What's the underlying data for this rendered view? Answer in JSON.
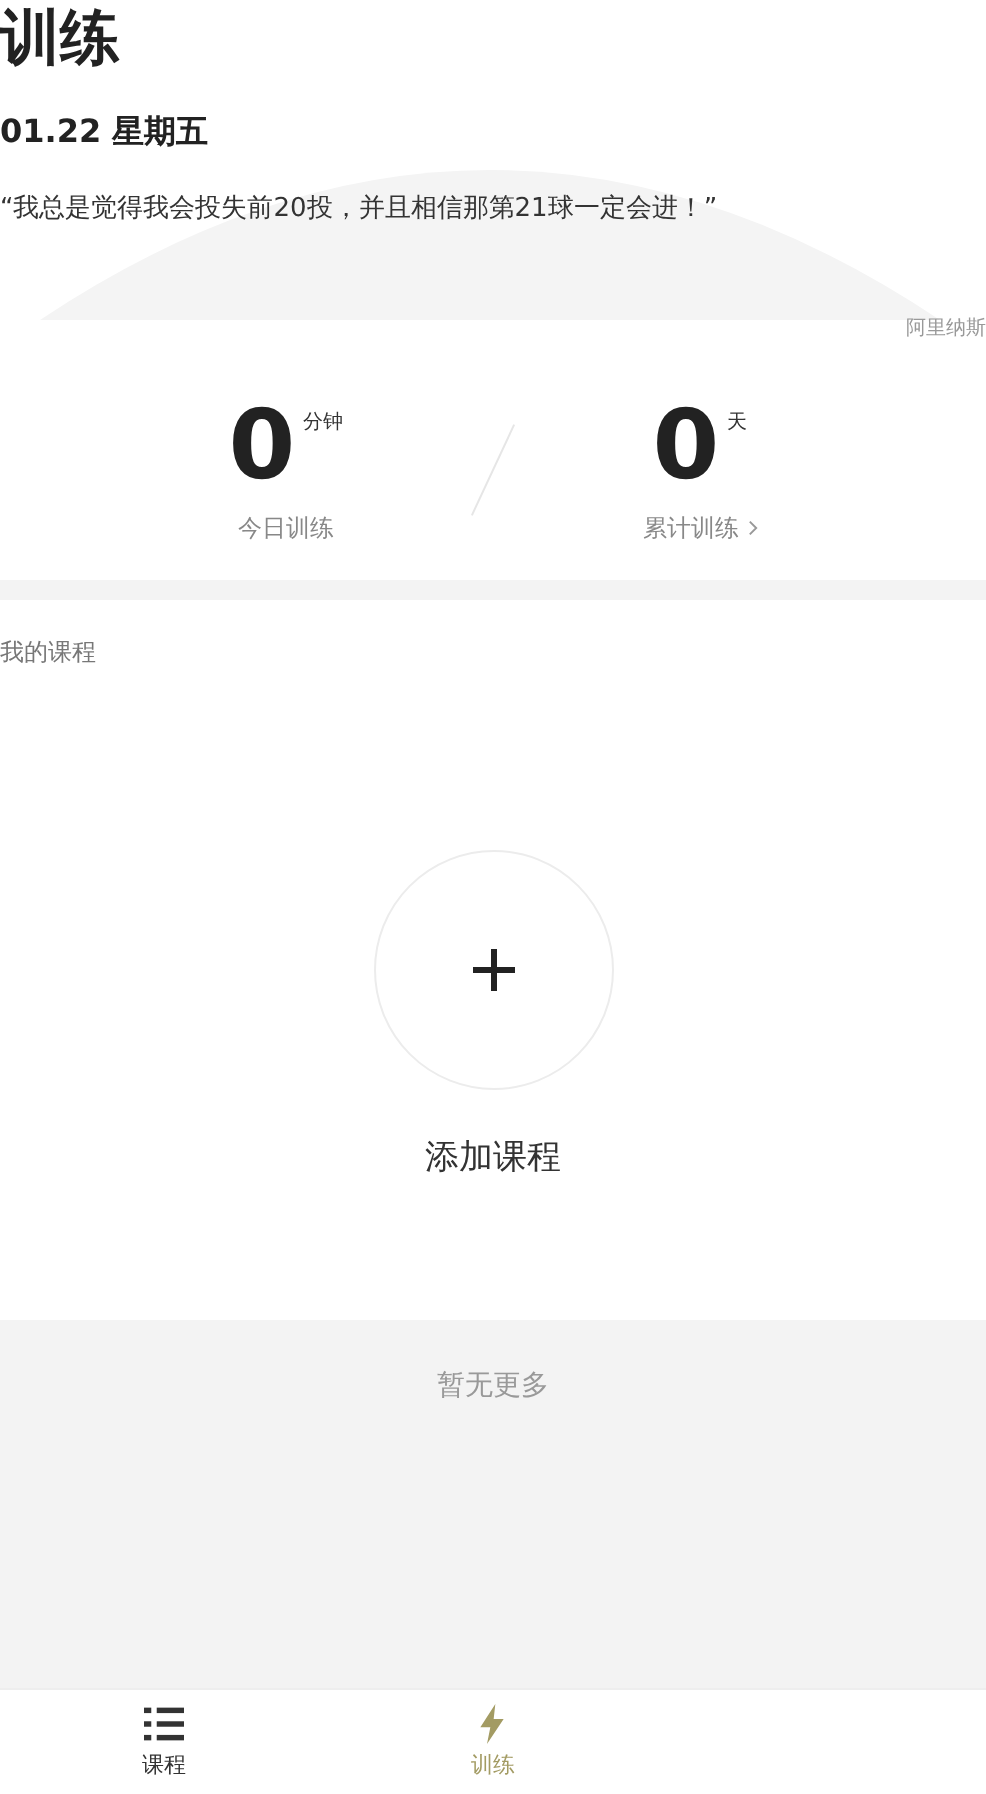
{
  "header": {
    "title": "训练",
    "date": "01.22 星期五",
    "quote": "“我总是觉得我会投失前20投，并且相信那第21球一定会进！”",
    "quote_author": "阿里纳斯"
  },
  "stats": [
    {
      "value": "0",
      "unit": "分钟",
      "label": "今日训练",
      "link": false
    },
    {
      "value": "0",
      "unit": "天",
      "label": "累计训练",
      "link": true
    }
  ],
  "courses": {
    "heading": "我的课程",
    "add_label": "添加课程"
  },
  "footer_note": "暂无更多",
  "tab_bar": [
    {
      "label": "课程",
      "kind": "list",
      "selected": false
    },
    {
      "label": "训练",
      "kind": "bolt",
      "selected": true
    }
  ]
}
